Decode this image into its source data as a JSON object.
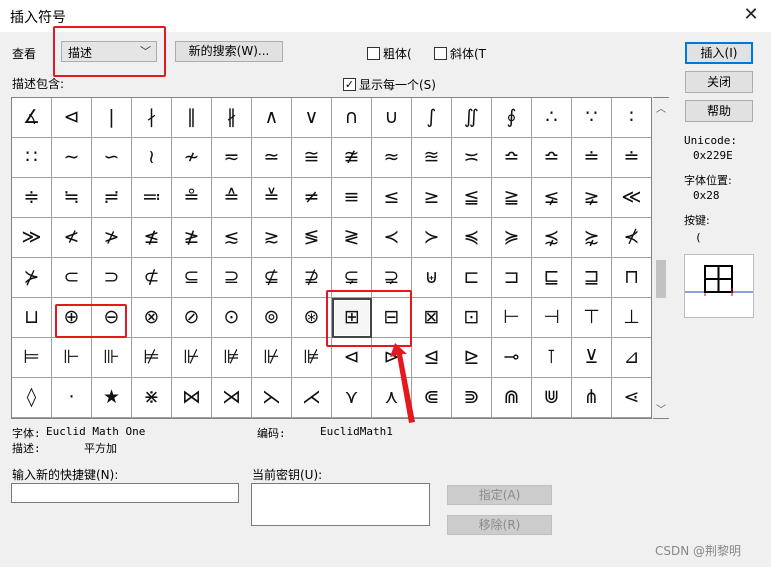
{
  "window": {
    "title": "插入符号",
    "close_glyph": "✕"
  },
  "toolbar": {
    "view_label": "查看",
    "view_select_value": "描述",
    "new_search_button": "新的搜索(W)...",
    "bold_label": "粗体(",
    "italic_label": "斜体(T",
    "describe_contains": "描述包含:",
    "show_each_label": "显示每一个(S)",
    "show_each_checked": "✓"
  },
  "actions": {
    "insert": "插入(I)",
    "close": "关闭",
    "help": "帮助"
  },
  "side_info": {
    "unicode_label": "Unicode:",
    "unicode_value": "0x229E",
    "font_pos_label": "字体位置:",
    "font_pos_value": "0x28",
    "key_label": "按键:",
    "key_value": "("
  },
  "symbols": [
    "∡",
    "⊲",
    "|",
    "∤",
    "∥",
    "∦",
    "∧",
    "∨",
    "∩",
    "∪",
    "∫",
    "∬",
    "∮",
    "∴",
    "∵",
    "∶",
    "∷",
    "∼",
    "∽",
    "≀",
    "≁",
    "≂",
    "≃",
    "≅",
    "≇",
    "≈",
    "≊",
    "≍",
    "≏",
    "≏",
    "≐",
    "≐",
    "≑",
    "≒",
    "≓",
    "≕",
    "≗",
    "≙",
    "≚",
    "≠",
    "≡",
    "≤",
    "≥",
    "≦",
    "≧",
    "⪇",
    "⪈",
    "≪",
    "≫",
    "≮",
    "≯",
    "≰",
    "≱",
    "≲",
    "≳",
    "≶",
    "≷",
    "≺",
    "≻",
    "≼",
    "≽",
    "⋨",
    "⋩",
    "⊀",
    "⊁",
    "⊂",
    "⊃",
    "⊄",
    "⊆",
    "⊇",
    "⊈",
    "⊉",
    "⊊",
    "⊋",
    "⊎",
    "⊏",
    "⊐",
    "⊑",
    "⊒",
    "⊓",
    "⊔",
    "⊕",
    "⊖",
    "⊗",
    "⊘",
    "⊙",
    "⊚",
    "⊛",
    "⊞",
    "⊟",
    "⊠",
    "⊡",
    "⊢",
    "⊣",
    "⊤",
    "⊥",
    "⊨",
    "⊩",
    "⊪",
    "⊭",
    "⊮",
    "⊯",
    "⊮",
    "⊯",
    "⊲",
    "⊳",
    "⊴",
    "⊵",
    "⊸",
    "⊺",
    "⊻",
    "⊿",
    "◊",
    "·",
    "★",
    "⋇",
    "⋈",
    "⋊",
    "⋋",
    "⋌",
    "⋎",
    "⋏",
    "⋐",
    "⋑",
    "⋒",
    "⋓",
    "⋔",
    "⋖"
  ],
  "selected_index": 88,
  "info": {
    "font_label": "字体:",
    "font_value": "Euclid Math One",
    "code_label": "编码:",
    "code_value": "EuclidMath1",
    "desc_label": "描述:",
    "desc_value": "平方加"
  },
  "shortcut": {
    "new_label": "输入新的快捷键(N):",
    "new_value": "",
    "current_label": "当前密钥(U):",
    "current_value": "",
    "assign": "指定(A)",
    "remove": "移除(R)"
  },
  "colors": {
    "annotation": "#e3191f",
    "accent": "#0078d7"
  },
  "watermark": "CSDN @荆黎明"
}
